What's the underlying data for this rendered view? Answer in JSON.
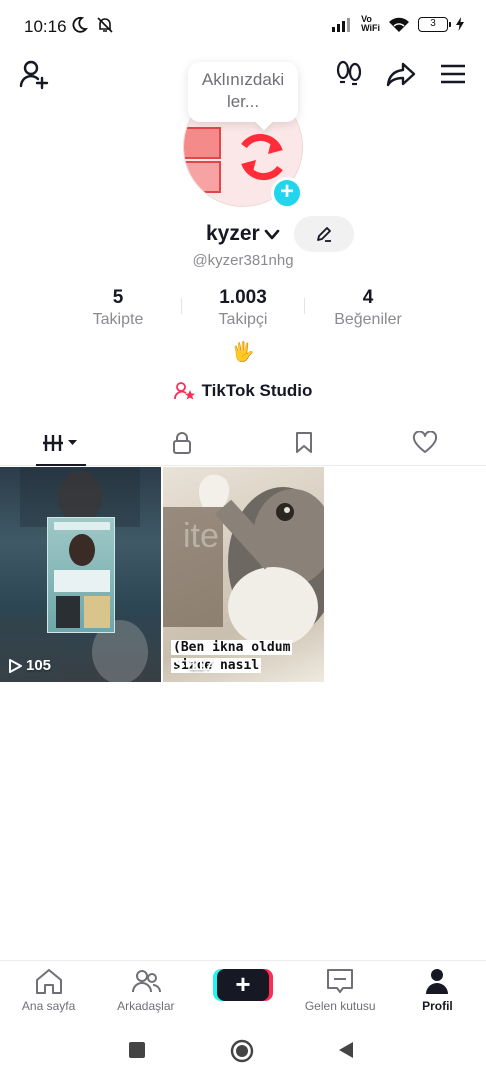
{
  "status_bar": {
    "time": "10:16",
    "vowifi_line1": "Vo",
    "vowifi_line2": "WiFi",
    "battery": "3"
  },
  "header": {
    "bubble_text_line1": "Aklınızdaki",
    "bubble_text_line2": "ler...",
    "username": "kyzer",
    "handle": "@kyzer381nhg"
  },
  "stats": [
    {
      "value": "5",
      "label": "Takipte"
    },
    {
      "value": "1.003",
      "label": "Takipçi"
    },
    {
      "value": "4",
      "label": "Beğeniler"
    }
  ],
  "bio": "🖐",
  "studio_label": "TikTok Studio",
  "tabs": {
    "icons": [
      "videos-grid-icon",
      "lock-icon",
      "bookmark-icon",
      "heart-icon"
    ],
    "active": 0
  },
  "videos": [
    {
      "views": "105"
    },
    {
      "views": "117",
      "caption_line1": "(Ben ikna oldum",
      "caption_line2": " sizce nasıl"
    }
  ],
  "bottom_nav": {
    "items": [
      {
        "label": "Ana sayfa"
      },
      {
        "label": "Arkadaşlar"
      },
      {
        "label": ""
      },
      {
        "label": "Gelen kutusu"
      },
      {
        "label": "Profil"
      }
    ],
    "create_symbol": "+"
  },
  "colors": {
    "accent_cyan": "#20d5ec",
    "brand_red": "#fe2c55",
    "text_primary": "#161823",
    "text_secondary": "#8a8b91"
  }
}
